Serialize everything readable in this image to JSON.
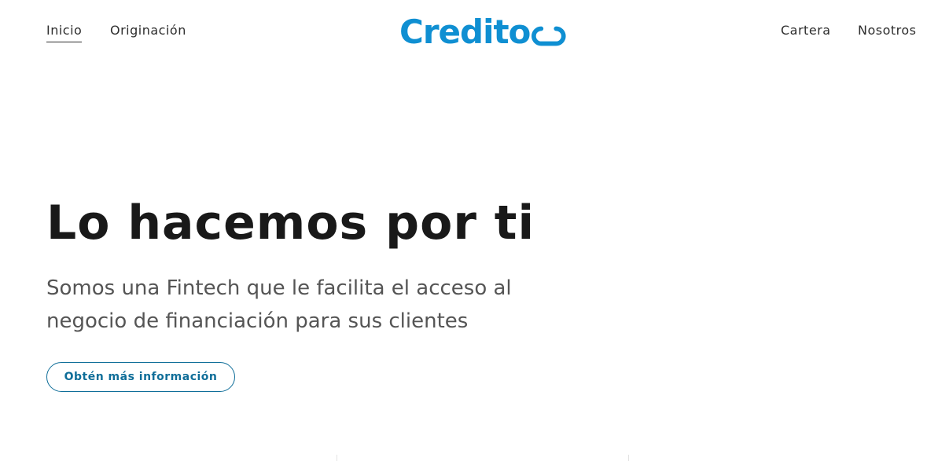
{
  "header": {
    "nav_left": [
      {
        "label": "Inicio",
        "active": true
      },
      {
        "label": "Originación",
        "active": false
      }
    ],
    "logo_text": "Credito",
    "nav_right": [
      {
        "label": "Cartera"
      },
      {
        "label": "Nosotros"
      }
    ]
  },
  "hero": {
    "title": "Lo hacemos por ti",
    "subtitle": "Somos una Fintech que le facilita el acceso al negocio de financiación para sus clientes",
    "cta_label": "Obtén más información"
  },
  "colors": {
    "brand": "#0f8fd2",
    "accent": "#0f6e99",
    "text_dark": "#191919",
    "text_muted": "#555555"
  },
  "icons": {
    "logo_mark": "infinity-loop-icon"
  }
}
